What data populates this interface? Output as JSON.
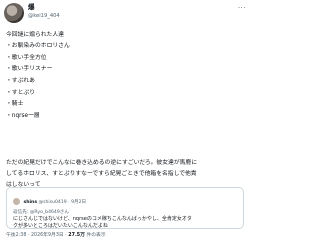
{
  "author": {
    "name": "爆",
    "handle": "@kei19_404",
    "more_icon": "more-horizontal-icon"
  },
  "tweet": {
    "intro": "今回謎に煽られた人達",
    "list": [
      "・お馴染みのホロリさん",
      "・歌い手全方位",
      "・歌い手リスナー",
      "・すぷれあ",
      "・すとぷり",
      "・騎士",
      "・nqrse一層"
    ],
    "closing_1": "ただの紀晃だけでこんなに巻き込めるの逆にすごいだろ。彼女達が馬鹿に",
    "closing_2": "してるホロリス、すとぷりすなーですら紀晃ごときで他箱を名指しで他責",
    "closing_3": "はしないって"
  },
  "quote": {
    "author_name": "shins",
    "author_handle": "@shisu0419",
    "date": "9月2日",
    "reply_prefix": "返信先:",
    "reply_handle": "@Ryo_b4649さん",
    "line1": "にじさんじではないけど、nqrseのコメ稼ちこんなんばっかやし、全肯定女オタ",
    "line2": "クが多いところはだいたいこんなんだよね",
    "label": "引用"
  },
  "meta": {
    "time": "午後2:38",
    "separator": "·",
    "date": "2026年9月3日",
    "views_count": "27.5万",
    "views_label": "件の表示"
  }
}
